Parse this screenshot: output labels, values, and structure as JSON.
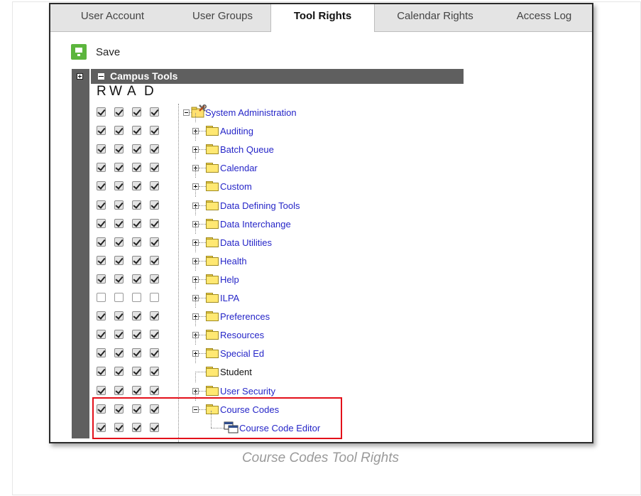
{
  "tabs": [
    {
      "label": "User Account",
      "active": false
    },
    {
      "label": "User Groups",
      "active": false
    },
    {
      "label": "Tool Rights",
      "active": true
    },
    {
      "label": "Calendar Rights",
      "active": false
    },
    {
      "label": "Access Log",
      "active": false
    }
  ],
  "toolbar": {
    "save_label": "Save"
  },
  "section": {
    "title": "Campus Tools"
  },
  "columns": [
    "R",
    "W",
    "A",
    "D"
  ],
  "tree": [
    {
      "label": "System Administration",
      "level": 0,
      "checked": [
        true,
        true,
        true,
        true
      ],
      "icon": "tools-folder-icon",
      "expander": "collapse",
      "link": true
    },
    {
      "label": "Auditing",
      "level": 1,
      "checked": [
        true,
        true,
        true,
        true
      ],
      "icon": "folder-icon",
      "expander": "expand",
      "link": true
    },
    {
      "label": "Batch Queue",
      "level": 1,
      "checked": [
        true,
        true,
        true,
        true
      ],
      "icon": "folder-icon",
      "expander": "expand",
      "link": true
    },
    {
      "label": "Calendar",
      "level": 1,
      "checked": [
        true,
        true,
        true,
        true
      ],
      "icon": "folder-icon",
      "expander": "expand",
      "link": true
    },
    {
      "label": "Custom",
      "level": 1,
      "checked": [
        true,
        true,
        true,
        true
      ],
      "icon": "folder-icon",
      "expander": "expand",
      "link": true
    },
    {
      "label": "Data Defining Tools",
      "level": 1,
      "checked": [
        true,
        true,
        true,
        true
      ],
      "icon": "folder-icon",
      "expander": "expand",
      "link": true
    },
    {
      "label": "Data Interchange",
      "level": 1,
      "checked": [
        true,
        true,
        true,
        true
      ],
      "icon": "folder-icon",
      "expander": "expand",
      "link": true
    },
    {
      "label": "Data Utilities",
      "level": 1,
      "checked": [
        true,
        true,
        true,
        true
      ],
      "icon": "folder-icon",
      "expander": "expand",
      "link": true
    },
    {
      "label": "Health",
      "level": 1,
      "checked": [
        true,
        true,
        true,
        true
      ],
      "icon": "folder-icon",
      "expander": "expand",
      "link": true
    },
    {
      "label": "Help",
      "level": 1,
      "checked": [
        true,
        true,
        true,
        true
      ],
      "icon": "folder-icon",
      "expander": "expand",
      "link": true
    },
    {
      "label": "ILPA",
      "level": 1,
      "checked": [
        false,
        false,
        false,
        false
      ],
      "icon": "folder-icon",
      "expander": "expand",
      "link": true
    },
    {
      "label": "Preferences",
      "level": 1,
      "checked": [
        true,
        true,
        true,
        true
      ],
      "icon": "folder-icon",
      "expander": "expand",
      "link": true
    },
    {
      "label": "Resources",
      "level": 1,
      "checked": [
        true,
        true,
        true,
        true
      ],
      "icon": "folder-icon",
      "expander": "expand",
      "link": true
    },
    {
      "label": "Special Ed",
      "level": 1,
      "checked": [
        true,
        true,
        true,
        true
      ],
      "icon": "folder-icon",
      "expander": "expand",
      "link": true
    },
    {
      "label": "Student",
      "level": 1,
      "checked": [
        true,
        true,
        true,
        true
      ],
      "icon": "folder-icon",
      "expander": "none",
      "link": false
    },
    {
      "label": "User Security",
      "level": 1,
      "checked": [
        true,
        true,
        true,
        true
      ],
      "icon": "folder-icon",
      "expander": "expand",
      "link": true
    },
    {
      "label": "Course Codes",
      "level": 1,
      "checked": [
        true,
        true,
        true,
        true
      ],
      "icon": "folder-icon",
      "expander": "collapse",
      "link": true
    },
    {
      "label": "Course Code Editor",
      "level": 2,
      "checked": [
        true,
        true,
        true,
        true
      ],
      "icon": "tool-window-icon",
      "expander": "none",
      "link": true
    }
  ],
  "caption": "Course Codes Tool Rights",
  "colors": {
    "accent_link": "#2626c8",
    "highlight": "#e3101a",
    "save_green": "#5cb53d",
    "header_bg": "#5f5f5f"
  }
}
